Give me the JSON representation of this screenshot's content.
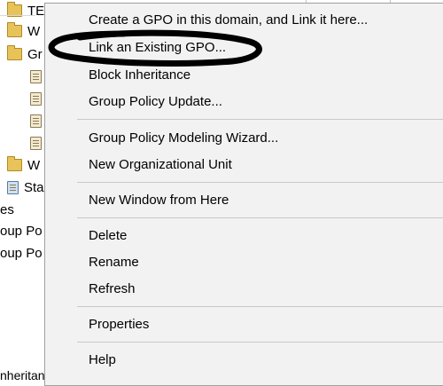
{
  "tree": {
    "items": [
      {
        "label": "TE",
        "icon": "folder-icon"
      },
      {
        "label": "W",
        "icon": "folder-icon"
      },
      {
        "label": "Gr",
        "icon": "folder-open-icon"
      },
      {
        "label": "",
        "icon": "gpo-link-icon"
      },
      {
        "label": "",
        "icon": "gpo-link-icon"
      },
      {
        "label": "",
        "icon": "gpo-link-icon"
      },
      {
        "label": "",
        "icon": "gpo-link-icon"
      },
      {
        "label": "W",
        "icon": "wmi-filter-folder-icon"
      },
      {
        "label": "Sta",
        "icon": "starter-gpo-folder-icon"
      },
      {
        "label": "es",
        "icon": ""
      },
      {
        "label": "oup Po",
        "icon": ""
      },
      {
        "label": "oup Po",
        "icon": ""
      }
    ],
    "status_text": "nheritanc"
  },
  "menu": {
    "items": {
      "create_gpo": "Create a GPO in this domain, and Link it here...",
      "link_existing": "Link an Existing GPO...",
      "block_inheritance": "Block Inheritance",
      "gp_update": "Group Policy Update...",
      "modeling_wizard": "Group Policy Modeling Wizard...",
      "new_ou": "New Organizational Unit",
      "new_window": "New Window from Here",
      "delete": "Delete",
      "rename": "Rename",
      "refresh": "Refresh",
      "properties": "Properties",
      "help": "Help"
    }
  },
  "colors": {
    "menu_background": "#f2f2f2",
    "separator": "#c9c9c9",
    "scribble": "#000000"
  }
}
